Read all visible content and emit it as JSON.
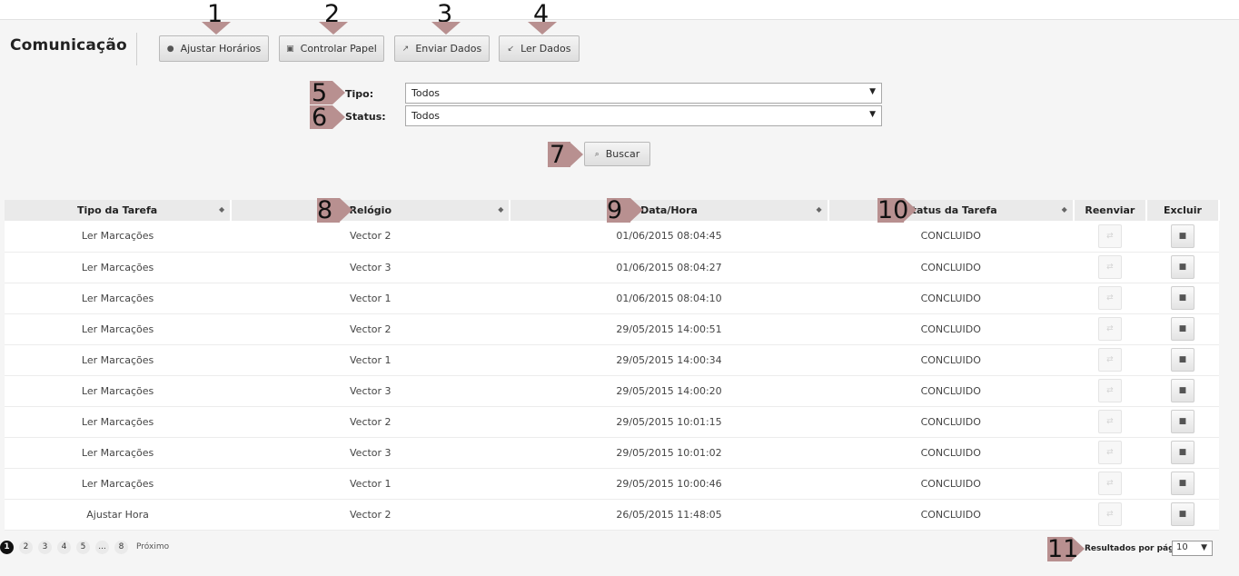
{
  "page": {
    "title": "Comunicação"
  },
  "toolbar": {
    "buttons": [
      {
        "label": "Ajustar Horários",
        "icon": "clock-icon",
        "glyph": "●"
      },
      {
        "label": "Controlar Papel",
        "icon": "printer-icon",
        "glyph": "▣"
      },
      {
        "label": "Enviar Dados",
        "icon": "send-arrow-icon",
        "glyph": "↗"
      },
      {
        "label": "Ler Dados",
        "icon": "receive-arrow-icon",
        "glyph": "↙"
      }
    ]
  },
  "filters": {
    "tipo": {
      "label": "Tipo:",
      "value": "Todos"
    },
    "status": {
      "label": "Status:",
      "value": "Todos"
    },
    "search_label": "Buscar",
    "search_glyph": "⌕"
  },
  "markers": [
    "1",
    "2",
    "3",
    "4",
    "5",
    "6",
    "7",
    "8",
    "9",
    "10",
    "11"
  ],
  "table": {
    "columns": [
      "Tipo da Tarefa",
      "Relógio",
      "Data/Hora",
      "Status da Tarefa",
      "Reenviar",
      "Excluir"
    ],
    "sort_glyph": "◆",
    "resend_glyph": "⇄",
    "delete_glyph": "■",
    "rows": [
      [
        "Ler Marcações",
        "Vector 2",
        "01/06/2015 08:04:45",
        "CONCLUIDO"
      ],
      [
        "Ler Marcações",
        "Vector 3",
        "01/06/2015 08:04:27",
        "CONCLUIDO"
      ],
      [
        "Ler Marcações",
        "Vector 1",
        "01/06/2015 08:04:10",
        "CONCLUIDO"
      ],
      [
        "Ler Marcações",
        "Vector 2",
        "29/05/2015 14:00:51",
        "CONCLUIDO"
      ],
      [
        "Ler Marcações",
        "Vector 1",
        "29/05/2015 14:00:34",
        "CONCLUIDO"
      ],
      [
        "Ler Marcações",
        "Vector 3",
        "29/05/2015 14:00:20",
        "CONCLUIDO"
      ],
      [
        "Ler Marcações",
        "Vector 2",
        "29/05/2015 10:01:15",
        "CONCLUIDO"
      ],
      [
        "Ler Marcações",
        "Vector 3",
        "29/05/2015 10:01:02",
        "CONCLUIDO"
      ],
      [
        "Ler Marcações",
        "Vector 1",
        "29/05/2015 10:00:46",
        "CONCLUIDO"
      ],
      [
        "Ajustar Hora",
        "Vector 2",
        "26/05/2015 11:48:05",
        "CONCLUIDO"
      ]
    ]
  },
  "pagination": {
    "pages": [
      "1",
      "2",
      "3",
      "4",
      "5",
      "...",
      "8"
    ],
    "active_page": "1",
    "next_label": "Próximo"
  },
  "results_per_page": {
    "label": "Resultados por página",
    "value": "10"
  },
  "colors": {
    "marker_arrow": "#b89090",
    "background": "#f5f5f5"
  }
}
